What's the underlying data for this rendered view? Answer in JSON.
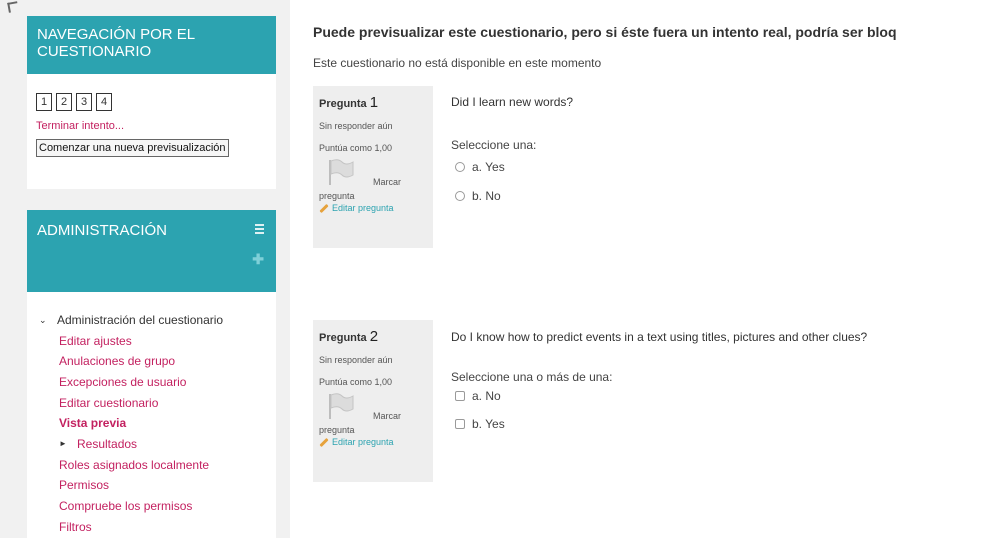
{
  "nav_block": {
    "title": "NAVEGACIÓN POR EL CUESTIONARIO",
    "question_buttons": [
      "1",
      "2",
      "3",
      "4"
    ],
    "finish_attempt": "Terminar intento...",
    "new_preview_button": "Comenzar una nueva previsualización"
  },
  "admin_block": {
    "title": "ADMINISTRACIÓN",
    "tree_parent": "Administración del cuestionario",
    "links": [
      "Editar ajustes",
      "Anulaciones de grupo",
      "Excepciones de usuario",
      "Editar cuestionario",
      "Vista previa",
      "Resultados",
      "Roles asignados localmente",
      "Permisos",
      "Compruebe los permisos",
      "Filtros"
    ]
  },
  "main": {
    "notice": "Puede previsualizar este cuestionario, pero si éste fuera un intento real, podría ser bloq",
    "unavailable": "Este cuestionario no está disponible en este momento",
    "questions": [
      {
        "label": "Pregunta",
        "number": "1",
        "status": "Sin responder aún",
        "grade": "Puntúa como 1,00",
        "flag_label_1": "Marcar",
        "flag_label_2": "pregunta",
        "edit": "Editar pregunta",
        "text": "Did I learn new words?",
        "prompt": "Seleccione una:",
        "options": [
          "a. Yes",
          "b. No"
        ]
      },
      {
        "label": "Pregunta",
        "number": "2",
        "status": "Sin responder aún",
        "grade": "Puntúa como 1,00",
        "flag_label_1": "Marcar",
        "flag_label_2": "pregunta",
        "edit": "Editar pregunta",
        "text": "Do I know how to predict events in a text using titles, pictures and other clues?",
        "prompt": "Seleccione una o más de una:",
        "options": [
          "a. No",
          "b. Yes"
        ]
      }
    ]
  },
  "colors": {
    "block_header": "#2ca3b0",
    "link": "#c32160",
    "sidebar_bg": "#f1f1f1",
    "question_info_bg": "#eeeeee"
  },
  "icons": {
    "collapse": "collapse-icon",
    "move": "move-icon",
    "flag": "flag-icon",
    "edit": "pencil-icon",
    "tree_open": "chevron-down-icon",
    "tree_closed": "chevron-right-icon"
  }
}
